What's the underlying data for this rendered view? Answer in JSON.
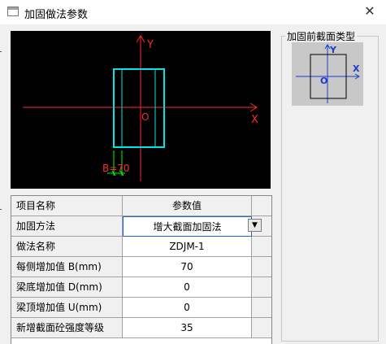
{
  "window": {
    "title": "加固做法参数",
    "close_glyph": "✕"
  },
  "canvas": {
    "y_label": "Y",
    "x_label": "X",
    "origin_label": "O",
    "dimension_label": "B=70",
    "colors": {
      "background": "#000000",
      "axis": "#ff2a2a",
      "section": "#00e5e5",
      "dimension": "#00ff00"
    }
  },
  "preview_group": {
    "title": "加固前截面类型",
    "y_label": "Y",
    "x_label": "X",
    "origin_label": "O"
  },
  "table": {
    "headers": [
      "项目名称",
      "参数值"
    ],
    "rows": [
      {
        "name": "加固方法",
        "value": "增大截面加固法",
        "dropdown": true
      },
      {
        "name": "做法名称",
        "value": "ZDJM-1"
      },
      {
        "name": "每侧增加值 B(mm)",
        "value": "70"
      },
      {
        "name": "梁底增加值 D(mm)",
        "value": "0"
      },
      {
        "name": "梁顶增加值 U(mm)",
        "value": "0"
      },
      {
        "name": "新增截面砼强度等级",
        "value": "35"
      }
    ]
  }
}
